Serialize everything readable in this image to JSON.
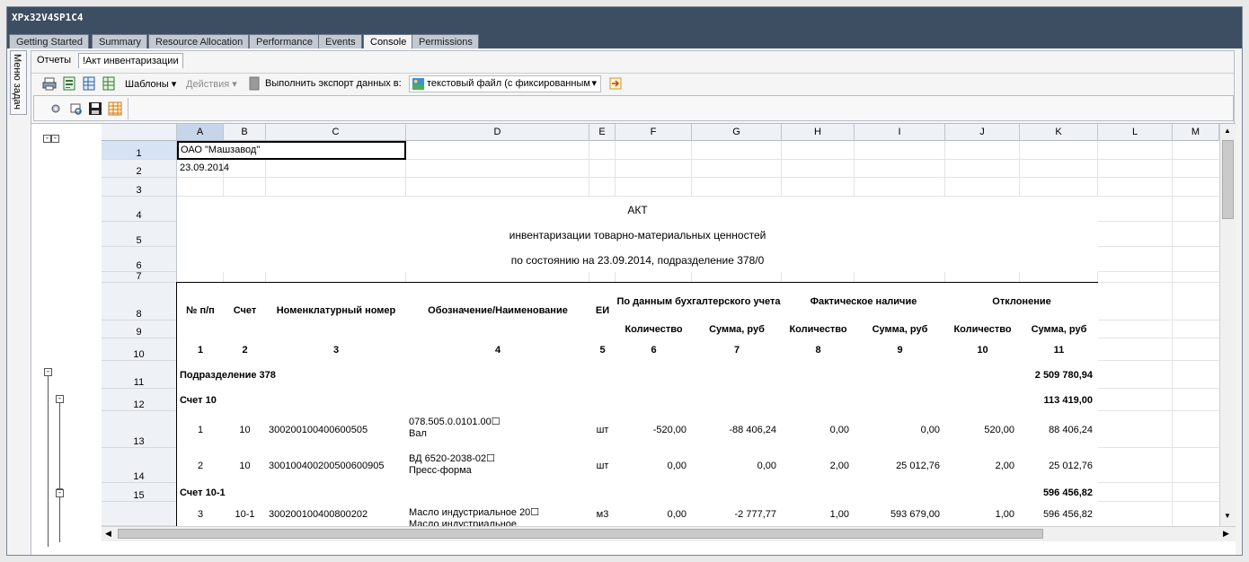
{
  "window": {
    "title": "XPx32V4SP1C4"
  },
  "tabs": [
    "Getting Started",
    "Summary",
    "Resource Allocation",
    "Performance",
    "Events",
    "Console",
    "Permissions"
  ],
  "active_tab": "Console",
  "sidebar": {
    "label": "Меню задач"
  },
  "subtabs": [
    "Отчеты",
    "!Акт инвентаризации"
  ],
  "toolbar": {
    "templates_label": "Шаблоны",
    "actions_label": "Действия",
    "export_label": "Выполнить экспорт данных в:",
    "export_format": "текстовый файл (с фиксированным"
  },
  "grid": {
    "columns": [
      "A",
      "B",
      "C",
      "D",
      "E",
      "F",
      "G",
      "H",
      "I",
      "J",
      "K",
      "L",
      "M"
    ],
    "row_numbers": [
      "1",
      "2",
      "3",
      "4",
      "5",
      "6",
      "7",
      "8",
      "9",
      "10",
      "11",
      "12",
      "13",
      "14",
      "15",
      ""
    ],
    "selected_cell": "A1",
    "cells": {
      "org": "ОАО \"Машзавод\"",
      "date": "23.09.2014",
      "title1": "АКТ",
      "title2": "инвентаризации товарно-материальных ценностей",
      "title3": "по состоянию на 23.09.2014, подразделение 378/0"
    },
    "headers": {
      "num": "№ п/п",
      "account": "Счет",
      "nomenclature": "Номенклатурный номер",
      "designation": "Обозначение/Наименование",
      "unit": "ЕИ",
      "accounting": "По данным бухгалтерского учета",
      "actual": "Фактическое наличие",
      "deviation": "Отклонение",
      "qty": "Количество",
      "sum": "Сумма, руб",
      "col_numbers": [
        "1",
        "2",
        "3",
        "4",
        "5",
        "6",
        "7",
        "8",
        "9",
        "10",
        "11"
      ]
    },
    "groups": [
      {
        "label": "Подразделение 378",
        "total": "2 509 780,94"
      },
      {
        "label": "Счет 10",
        "total": "113 419,00"
      },
      {
        "label": "Счет 10-1",
        "total": "596 456,82"
      }
    ],
    "items": [
      {
        "n": "1",
        "acc": "10",
        "nom": "300200100400600505",
        "name1": "078.505.0.0101.00☐",
        "name2": "Вал",
        "unit": "шт",
        "q1": "-520,00",
        "s1": "-88 406,24",
        "q2": "0,00",
        "s2": "0,00",
        "q3": "520,00",
        "s3": "88 406,24"
      },
      {
        "n": "2",
        "acc": "10",
        "nom": "300100400200500600905",
        "name1": "ВД 6520-2038-02☐",
        "name2": "Пресс-форма",
        "unit": "шт",
        "q1": "0,00",
        "s1": "0,00",
        "q2": "2,00",
        "s2": "25 012,76",
        "q3": "2,00",
        "s3": "25 012,76"
      },
      {
        "n": "3",
        "acc": "10-1",
        "nom": "300200100400800202",
        "name1": "Масло индустриальное 20☐",
        "name2": "Масло индустриальное",
        "unit": "м3",
        "q1": "0,00",
        "s1": "-2 777,77",
        "q2": "1,00",
        "s2": "593 679,00",
        "q3": "1,00",
        "s3": "596 456,82"
      }
    ]
  }
}
